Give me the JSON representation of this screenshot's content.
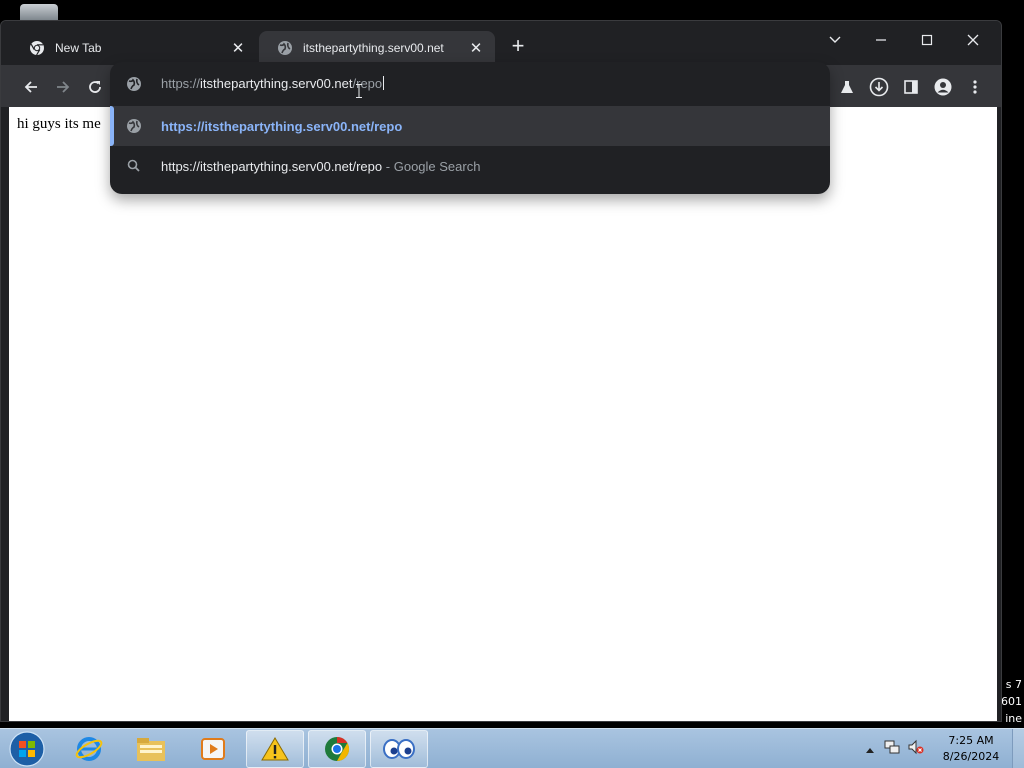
{
  "desktop": {
    "watermark_lines": [
      "s 7",
      "601",
      "ine"
    ]
  },
  "browser": {
    "tabs": [
      {
        "title": "New Tab",
        "favicon": "chrome-icon",
        "active": false
      },
      {
        "title": "itsthepartything.serv00.net",
        "favicon": "globe-icon",
        "active": true
      }
    ],
    "new_tab_label": "+",
    "omnibox": {
      "scheme": "https://",
      "host": "itsthepartything.serv00.net",
      "path": "/repo",
      "suggestions": [
        {
          "type": "url",
          "icon": "globe-icon",
          "text": "https://itsthepartything.serv00.net/repo",
          "selected": true
        },
        {
          "type": "search",
          "icon": "search-icon",
          "query": "https://itsthepartything.serv00.net/repo",
          "separator": "-",
          "provider": "Google Search",
          "selected": false
        }
      ]
    },
    "page": {
      "text": "hi guys its me"
    },
    "accent_color": "#8ab4f8"
  },
  "taskbar": {
    "items": [
      {
        "name": "internet-explorer"
      },
      {
        "name": "file-explorer"
      },
      {
        "name": "media-player"
      },
      {
        "name": "warning-app",
        "running": true
      },
      {
        "name": "chrome",
        "running": true
      },
      {
        "name": "eyes-app",
        "running": true
      }
    ],
    "clock": {
      "time": "7:25 AM",
      "date": "8/26/2024"
    }
  }
}
